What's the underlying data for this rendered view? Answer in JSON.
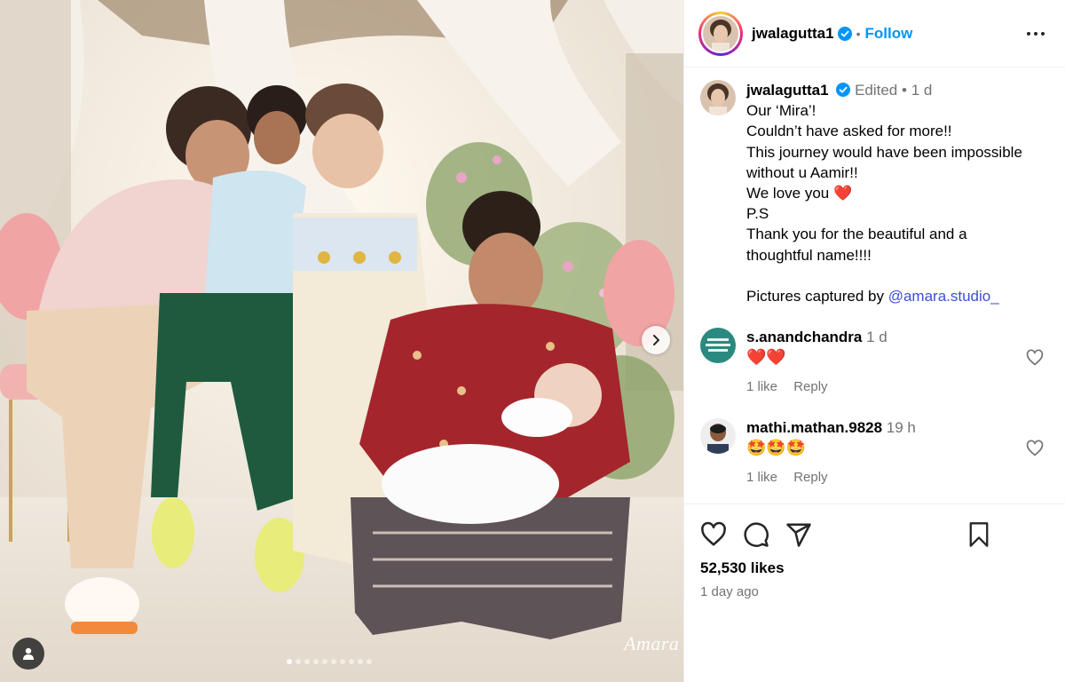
{
  "photo": {
    "watermark": "Amara",
    "carousel_dots": 10,
    "active_dot": 0
  },
  "header": {
    "username": "jwalagutta1",
    "separator": "•",
    "follow_label": "Follow"
  },
  "caption": {
    "username": "jwalagutta1",
    "edited": "Edited",
    "separator": "•",
    "time": "1 d",
    "lines": [
      "Our ‘Mira’!",
      "Couldn’t have asked for more!!",
      "This journey would have been impossible",
      "without u Aamir!!",
      "We love you ❤️",
      "P.S",
      "Thank you for the beautiful and a",
      "thoughtful name!!!!",
      "",
      "Pictures captured by "
    ],
    "mention": "@amara.studio_"
  },
  "comments": [
    {
      "username": "s.anandchandra",
      "time": "1 d",
      "text": "❤️❤️",
      "likes": "1 like",
      "reply": "Reply"
    },
    {
      "username": "mathi.mathan.9828",
      "time": "19 h",
      "text": "🤩🤩🤩",
      "likes": "1 like",
      "reply": "Reply"
    }
  ],
  "footer": {
    "likes": "52,530 likes",
    "time": "1 day ago"
  },
  "icons": {
    "verified": "verified-badge-icon",
    "more": "more-options-icon",
    "like": "heart-icon",
    "comment": "comment-icon",
    "share": "share-icon",
    "save": "bookmark-icon",
    "next": "chevron-right-icon",
    "user_tag": "user-tag-icon"
  },
  "colors": {
    "accent": "#0095f6",
    "verified": "#0095f6",
    "muted": "#737373"
  }
}
